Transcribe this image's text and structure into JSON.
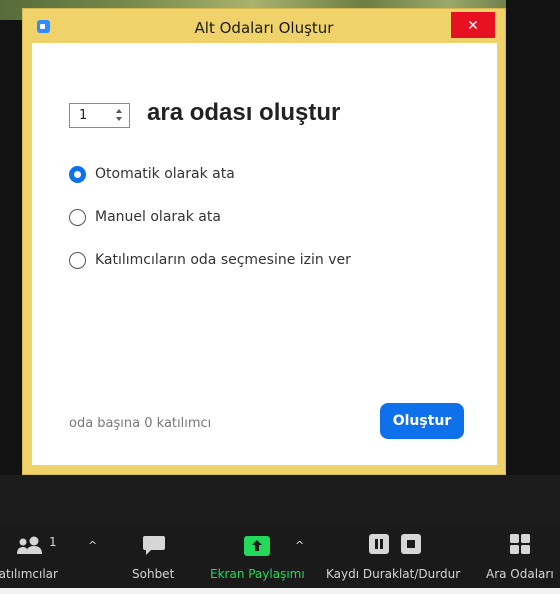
{
  "dialog": {
    "title": "Alt Odaları Oluştur",
    "close_label": "✕",
    "room_count": "1",
    "create_suffix": "ara odası oluştur",
    "options": [
      {
        "label": "Otomatik olarak ata",
        "selected": true
      },
      {
        "label": "Manuel olarak ata",
        "selected": false
      },
      {
        "label": "Katılımcıların oda seçmesine izin ver",
        "selected": false
      }
    ],
    "participants_note": "oda başına 0 katılımcı",
    "create_button": "Oluştur"
  },
  "toolbar": {
    "participants_label": "Katılımcılar",
    "participants_count": "1",
    "chat_label": "Sohbet",
    "share_label": "Ekran Paylaşımı",
    "record_label": "Kaydı Duraklat/Durdur",
    "breakout_label": "Ara Odaları"
  },
  "colors": {
    "dialog_frame": "#f0d26a",
    "accent_blue": "#0e71eb",
    "share_green": "#23d959",
    "close_red": "#e81123"
  }
}
